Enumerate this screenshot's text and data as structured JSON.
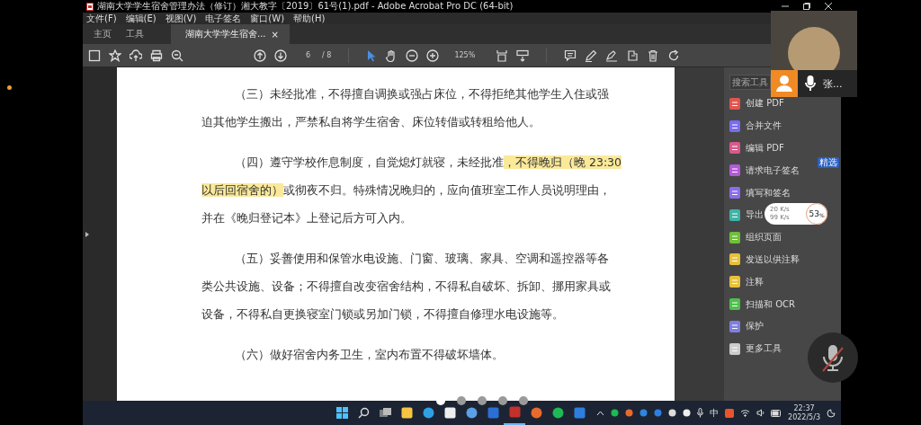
{
  "window": {
    "title": "湖南大学学生宿舍管理办法（修订）湘大教字〔2019〕61号(1).pdf - Adobe Acrobat Pro DC (64-bit)"
  },
  "menu": [
    "文件(F)",
    "编辑(E)",
    "视图(V)",
    "电子签名",
    "窗口(W)",
    "帮助(H)"
  ],
  "tabs": [
    {
      "label": "主页",
      "selected": false
    },
    {
      "label": "工具",
      "selected": false
    },
    {
      "label": "湖南大学学生宿舍...",
      "selected": true,
      "close": "×"
    }
  ],
  "toolbar": {
    "page_current": "6",
    "page_total": "/ 8",
    "zoom": "125%"
  },
  "document": {
    "paragraphs": [
      {
        "lines": [
          [
            {
              "text": "（三）未经批准，不得擅自调换或强占床位，不得拒绝其他学生入住或强",
              "highlighted": false
            }
          ],
          [
            {
              "text": "迫其他学生搬出，严禁私自将学生宿舍、床位转借或转租给他人。",
              "highlighted": false
            }
          ]
        ]
      },
      {
        "lines": [
          [
            {
              "text": "（四）遵守学校作息制度，自觉熄灯就寝，未经批准",
              "highlighted": false
            },
            {
              "text": "，不得晚归（晚 23:30",
              "highlighted": true
            }
          ],
          [
            {
              "text": "以后回宿舍的）",
              "highlighted": true
            },
            {
              "text": "或彻夜不归。特殊情况晚归的，应向值班室工作人员说明理由，",
              "highlighted": false
            }
          ],
          [
            {
              "text": "并在《晚归登记本》上登记后方可入内。",
              "highlighted": false
            }
          ]
        ]
      },
      {
        "lines": [
          [
            {
              "text": "（五）妥善使用和保管水电设施、门窗、玻璃、家具、空调和遥控器等各",
              "highlighted": false
            }
          ],
          [
            {
              "text": "类公共设施、设备；不得擅自改变宿舍结构，不得私自破坏、拆卸、挪用家具或",
              "highlighted": false
            }
          ],
          [
            {
              "text": "设备，不得私自更换寝室门锁或另加门锁，不得擅自修理水电设施等。",
              "highlighted": false
            }
          ]
        ]
      },
      {
        "lines": [
          [
            {
              "text": "（六）做好宿舍内务卫生，室内布置不得破坏墙体。",
              "highlighted": false
            }
          ]
        ]
      }
    ]
  },
  "tools_panel": {
    "search": {
      "placeholder": "搜索工具"
    },
    "items": [
      {
        "label": "创建 PDF",
        "color": "#e0564f"
      },
      {
        "label": "合并文件",
        "color": "#7a6cf0"
      },
      {
        "label": "编辑 PDF",
        "color": "#d85a8a"
      },
      {
        "label": "请求电子签名",
        "color": "#b35ad8",
        "badge": "精选"
      },
      {
        "label": "填写和签名",
        "color": "#8a6cf0"
      },
      {
        "label": "导出",
        "color": "#3fb3a8"
      },
      {
        "label": "组织页面",
        "color": "#6fbf3b"
      },
      {
        "label": "发送以供注释",
        "color": "#e8c13a"
      },
      {
        "label": "注释",
        "color": "#e8c13a"
      },
      {
        "label": "扫描和 OCR",
        "color": "#4fbf4f"
      },
      {
        "label": "保护",
        "color": "#7f7fe0"
      },
      {
        "label": "更多工具",
        "color": "#cccccc"
      }
    ]
  },
  "video_tile": {
    "name": "张..."
  },
  "network_widget": {
    "upload": "20 K/s",
    "download": "99 K/s",
    "percent": "53",
    "percent_sign": "%"
  },
  "page_dots": [
    {
      "selected": true
    },
    {
      "selected": false
    },
    {
      "selected": false
    },
    {
      "selected": false
    },
    {
      "selected": false
    }
  ],
  "taskbar": {
    "time": "22:37",
    "date": "2022/5/3",
    "ime": "中"
  }
}
